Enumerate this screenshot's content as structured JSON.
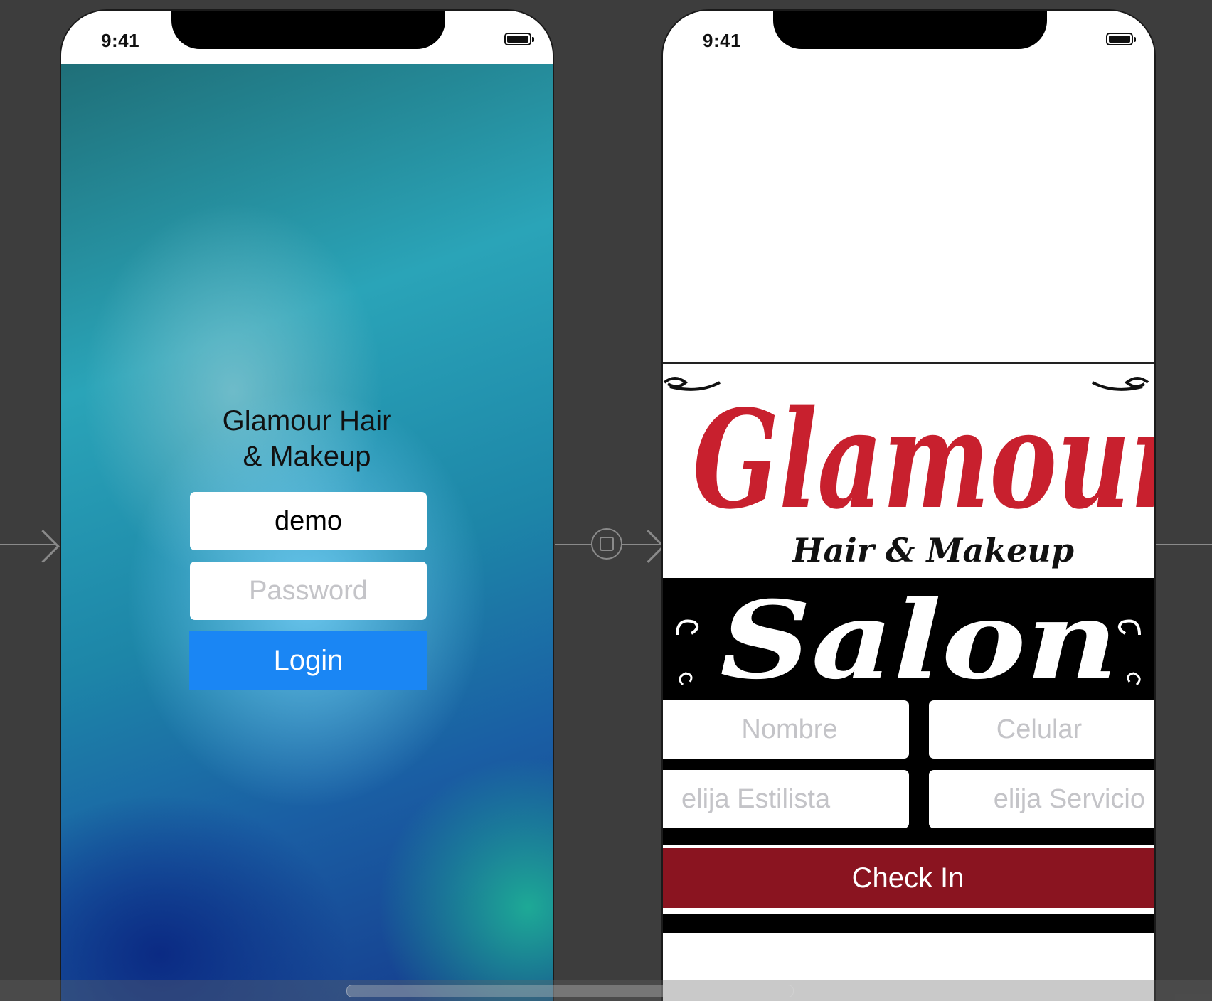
{
  "left_screen": {
    "time": "9:41",
    "title": "Glamour Hair\n& Makeup",
    "username_value": "demo",
    "password_placeholder": "Password",
    "login_label": "Login"
  },
  "right_screen": {
    "time": "9:41",
    "logo": {
      "brand": "Glamour",
      "tagline": "Hair & Makeup",
      "salon": "Salon"
    },
    "fields": {
      "nombre_placeholder": "Nombre",
      "celular_placeholder": "Celular",
      "estilista_placeholder": "elija Estilista",
      "servicio_placeholder": "elija Servicio"
    },
    "checkin_label": "Check In"
  },
  "colors": {
    "login_button": "#1a86f4",
    "checkin_button": "#8a1420",
    "logo_red": "#c8202e",
    "canvas": "#3d3d3d"
  },
  "icons": [
    "battery-icon",
    "segue-icon",
    "arrow-icon"
  ]
}
